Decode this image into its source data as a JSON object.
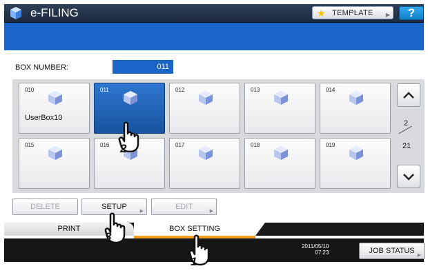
{
  "header": {
    "title": "e-FILING",
    "template_label": "TEMPLATE",
    "help_label": "?"
  },
  "box_number": {
    "label": "BOX NUMBER:",
    "value": "011"
  },
  "boxes": [
    {
      "num": "010",
      "name": "UserBox10",
      "selected": false
    },
    {
      "num": "011",
      "name": "",
      "selected": true
    },
    {
      "num": "012",
      "name": "",
      "selected": false
    },
    {
      "num": "013",
      "name": "",
      "selected": false
    },
    {
      "num": "014",
      "name": "",
      "selected": false
    },
    {
      "num": "015",
      "name": "",
      "selected": false
    },
    {
      "num": "016",
      "name": "",
      "selected": false
    },
    {
      "num": "017",
      "name": "",
      "selected": false
    },
    {
      "num": "018",
      "name": "",
      "selected": false
    },
    {
      "num": "019",
      "name": "",
      "selected": false
    }
  ],
  "pagination": {
    "current": "2",
    "total": "21"
  },
  "actions": {
    "delete_label": "DELETE",
    "setup_label": "SETUP",
    "edit_label": "EDIT"
  },
  "tabs": {
    "print_label": "PRINT",
    "box_setting_label": "BOX SETTING"
  },
  "footer": {
    "date": "2011/05/10",
    "time": "07:23",
    "job_status_label": "JOB STATUS"
  },
  "steps": [
    "1",
    "2",
    "3"
  ],
  "colors": {
    "header_bg": "#1d2a3e",
    "banner_blue": "#1b64c8",
    "selected_tile": "#17549f",
    "tab_accent": "#f0a020",
    "help_blue": "#1280cc"
  }
}
